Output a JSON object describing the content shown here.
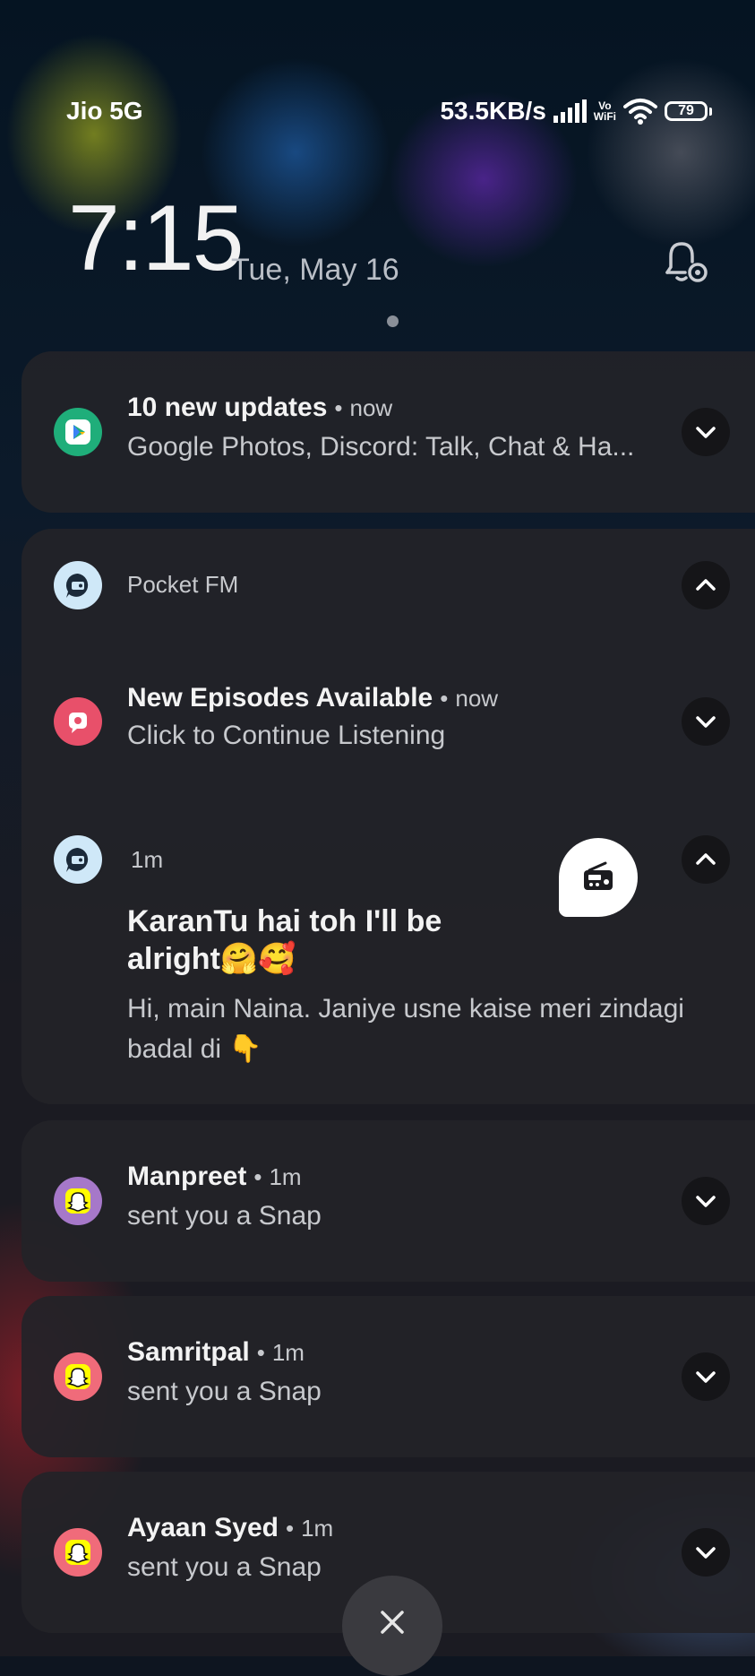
{
  "status_bar": {
    "carrier": "Jio 5G",
    "speed": "53.5KB/s",
    "vowifi_top": "Vo",
    "vowifi_bottom": "WiFi",
    "battery": "79"
  },
  "lock": {
    "time": "7:15",
    "date": "Tue, May 16"
  },
  "notifications": {
    "play": {
      "title": "10 new updates",
      "time": "now",
      "body": "Google Photos, Discord: Talk, Chat & Ha..."
    },
    "pocket_group": {
      "app_name": "Pocket FM",
      "episodes": {
        "title": "New Episodes Available",
        "time": "now",
        "body": "Click to Continue Listening"
      },
      "story": {
        "time": "1m",
        "title": "KaranTu hai toh I'll be alright🤗🥰",
        "body": "Hi, main Naina. Janiye usne kaise meri zindagi badal di 👇"
      }
    },
    "snaps": [
      {
        "title": "Manpreet",
        "time": "1m",
        "body": "sent you a Snap",
        "color": "#a678c9"
      },
      {
        "title": "Samritpal",
        "time": "1m",
        "body": "sent you a Snap",
        "color": "#f06b7a"
      },
      {
        "title": "Ayaan Syed",
        "time": "1m",
        "body": "sent you a Snap",
        "color": "#f06b7a"
      }
    ],
    "dot": "•"
  },
  "colors": {
    "snap_yellow": "#fffc00",
    "play_green": "#1fae7a",
    "pocket_light": "#cfe8f8",
    "pocket_pink": "#e8506a"
  },
  "icons": {
    "play": "google-play-icon",
    "pocket": "pocket-fm-icon",
    "snap": "snapchat-ghost-icon",
    "expand": "chevron-down-icon",
    "collapse": "chevron-up-icon",
    "dismiss": "close-icon"
  }
}
